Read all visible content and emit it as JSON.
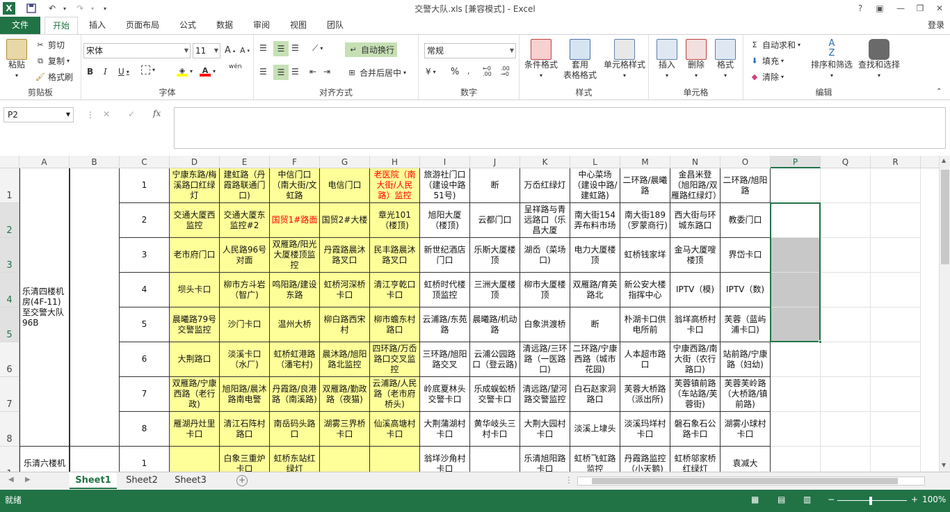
{
  "window": {
    "title": "交警大队.xls  [兼容模式] - Excel",
    "help": "?",
    "login": "登录"
  },
  "quickaccess": {
    "save_icon": "save-icon",
    "undo_icon": "undo-icon",
    "redo_icon": "redo-icon"
  },
  "tabs": [
    "文件",
    "开始",
    "插入",
    "页面布局",
    "公式",
    "数据",
    "审阅",
    "视图",
    "团队"
  ],
  "ribbon": {
    "clipboard": {
      "paste": "粘贴",
      "cut": "剪切",
      "copy": "复制",
      "painter": "格式刷",
      "label": "剪贴板"
    },
    "font": {
      "name": "宋体",
      "size": "11",
      "label": "字体",
      "phonetic": "wén"
    },
    "align": {
      "wrap": "自动换行",
      "merge": "合并后居中",
      "label": "对齐方式"
    },
    "number": {
      "format": "常规",
      "label": "数字",
      "percent": "%"
    },
    "styles": {
      "cond": "条件格式",
      "table1": "套用",
      "table2": "表格格式",
      "cell": "单元格样式",
      "label": "样式"
    },
    "cells": {
      "insert": "插入",
      "delete": "删除",
      "format": "格式",
      "label": "单元格"
    },
    "edit": {
      "autosum": "自动求和",
      "fill": "填充",
      "clear": "清除",
      "sort": "排序和筛选",
      "find": "查找和选择",
      "label": "编辑"
    }
  },
  "formula": {
    "namebox": "P2",
    "fx": "fx",
    "value": ""
  },
  "columns": [
    "A",
    "B",
    "C",
    "D",
    "E",
    "F",
    "G",
    "H",
    "I",
    "J",
    "K",
    "L",
    "M",
    "N",
    "O",
    "P",
    "Q",
    "R"
  ],
  "rows": [
    "1",
    "2",
    "3",
    "4",
    "5",
    "6",
    "7",
    "8",
    "1"
  ],
  "group1": "乐清四楼机房(4F-11)至交警大队96B",
  "group2": "乐清六楼机",
  "grid": [
    [
      "宁康东路/梅溪路口红绿灯",
      "建虹路（丹霞路联通门口)",
      "中信门口（南大街/文虹路",
      "电信门口",
      "老医院（南大街/人民路）监控",
      "旅游社门口（建设中路51号)",
      "断",
      "万岙红绿灯",
      "中心菜场（建设中路/建虹路)",
      "二环路/晨曦路",
      "金昌米登（旭阳路/双雁路红绿灯）",
      "二环路/旭阳路"
    ],
    [
      "交通大厦西监控",
      "交通大厦东监控#2",
      "国贸1#路面",
      "国贸2#大楼",
      "章光101（楼顶)",
      "旭阳大厦（楼顶)",
      "云都门口",
      "呈祥路与青远路口（乐昌大厦",
      "南大街154弄布料市场",
      "南大街189（罗蒙商行)",
      "西大街与环城东路口",
      "教委门口"
    ],
    [
      "老市府门口",
      "人民路96号对面",
      "双雁路/阳光大厦楼顶监控",
      "丹霞路晨沐路叉口",
      "民丰路晨沐路叉口",
      "新世纪酒店门口",
      "乐斯大厦楼顶",
      "湖岙（菜场口)",
      "电力大厦楼顶",
      "虹桥钱家垟",
      "金马大厦嗖楼顶",
      "界岱卡口"
    ],
    [
      "坝头卡口",
      "柳市方斗岩（智广)",
      "鸣阳路/建设东路",
      "虹桥河深桥卡口",
      "清江亨乾口卡口",
      "虹桥时代楼顶监控",
      "三洲大厦楼顶",
      "柳市大厦楼顶",
      "双雁路/育英路北",
      "新公安大楼指挥中心",
      "IPTV（模)",
      "IPTV（数)"
    ],
    [
      "晨曦路79号交警监控",
      "沙门卡口",
      "温州大桥",
      "柳白路西宋村",
      "柳市蟾东村路口",
      "云浦路/东苑路",
      "晨曦路/机动路",
      "白象洪渡桥",
      "断",
      "朴湖卡口供电所前",
      "翁垟高桥村卡口",
      "芙蓉（蓝屿浦卡口)"
    ],
    [
      "大荆路口",
      "淡溪卡口（水厂)",
      "虹桥虹港路（潘宅村)",
      "晨沐路/旭阳路北监控",
      "四环路/万岙路口交叉监控",
      "三环路/旭阳路交叉",
      "云浦公园路口（登云路)",
      "清远路/三环路（一医路口)",
      "二环路/宁康西路（城市花园)",
      "人本超市路口",
      "宁康西路/南大街（农行路口)",
      "站前路/宁康路（妇幼)"
    ],
    [
      "双雁路/宁康西路（老行政)",
      "旭阳路/晨沐路南电警",
      "丹霞路/良港路（南溪路)",
      "双雁路/勤政路（夜猫)",
      "云浦路/人民路（老市府桥头)",
      "岭底夏林头交警卡口",
      "乐成蜈蚣桥交警卡口",
      "清远路/望河路交警监控",
      "白石赵家洞路口",
      "芙蓉大桥路（派出所)",
      "芙蓉镇前路（车站路/芙蓉街)",
      "芙蓉芙岭路（大桥路/镇前路)"
    ],
    [
      "雁湖丹灶里卡口",
      "清江石阵村路口",
      "南岳码头路口",
      "湖雾三界桥卡口",
      "仙溪高塘村卡口",
      "大荆蒲湖村卡口",
      "黄华岐头三村卡口",
      "大荆大园村卡口",
      "淡溪上埭头",
      "淡溪玛垟村卡口",
      "磐石象石公路卡口",
      "湖雾小球村卡口"
    ],
    [
      "",
      "白象三重炉卡口",
      "虹桥东站红绿灯",
      "",
      "",
      "翁垟沙角村卡口",
      "",
      "乐清旭阳路卡口",
      "虹桥飞虹路监控",
      "丹霞路监控（小天鹅)",
      "虹桥邬家桥红绿灯",
      "袁减大"
    ]
  ],
  "sheets": [
    "Sheet1",
    "Sheet2",
    "Sheet3"
  ],
  "status": {
    "ready": "就绪",
    "zoom": "100%"
  }
}
